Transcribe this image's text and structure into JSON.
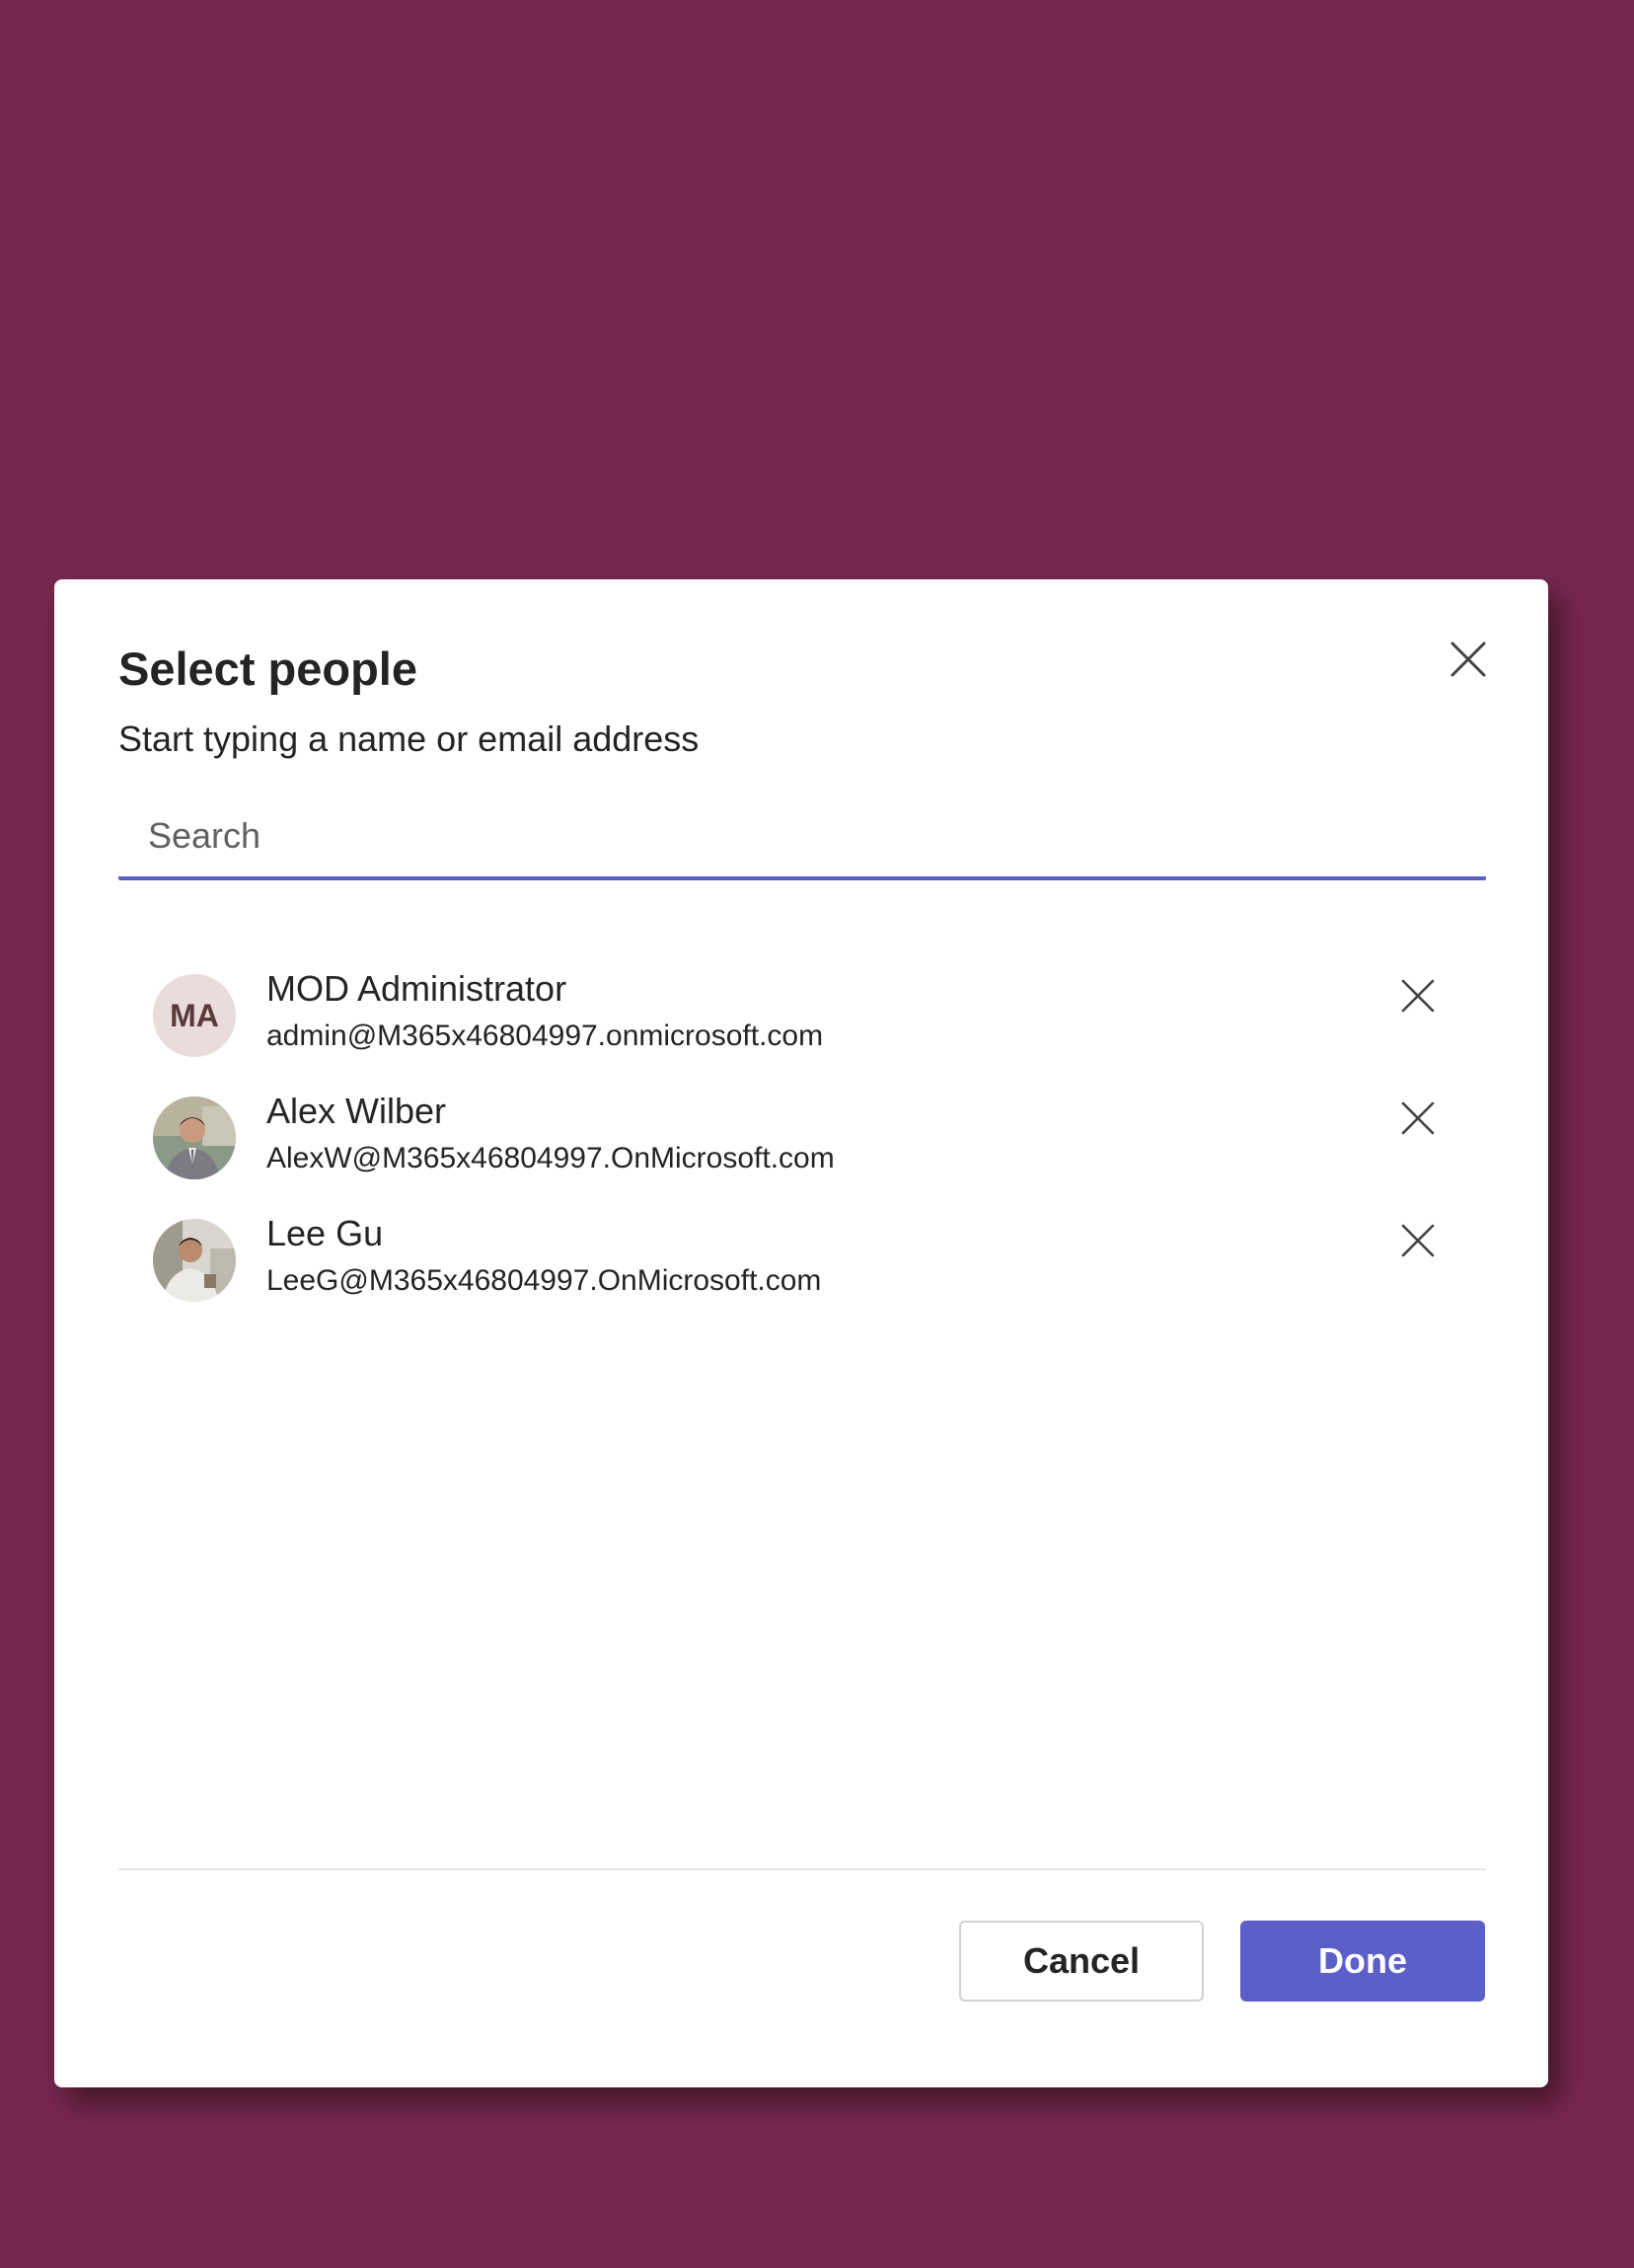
{
  "dialog": {
    "title": "Select people",
    "subtitle": "Start typing a name or email address",
    "close_icon": "close-icon",
    "search": {
      "placeholder": "Search",
      "value": ""
    },
    "people": [
      {
        "name": "MOD Administrator",
        "email": "admin@M365x46804997.onmicrosoft.com",
        "initials": "MA",
        "avatar_type": "initials",
        "remove_icon": "close-icon"
      },
      {
        "name": "Alex Wilber",
        "email": "AlexW@M365x46804997.OnMicrosoft.com",
        "initials": "",
        "avatar_type": "photo",
        "remove_icon": "close-icon"
      },
      {
        "name": "Lee Gu",
        "email": "LeeG@M365x46804997.OnMicrosoft.com",
        "initials": "",
        "avatar_type": "photo",
        "remove_icon": "close-icon"
      }
    ],
    "buttons": {
      "cancel_label": "Cancel",
      "done_label": "Done"
    }
  },
  "colors": {
    "background": "#77274f",
    "accent": "#5b5fc7",
    "dialog_bg": "#ffffff",
    "text": "#242424"
  }
}
